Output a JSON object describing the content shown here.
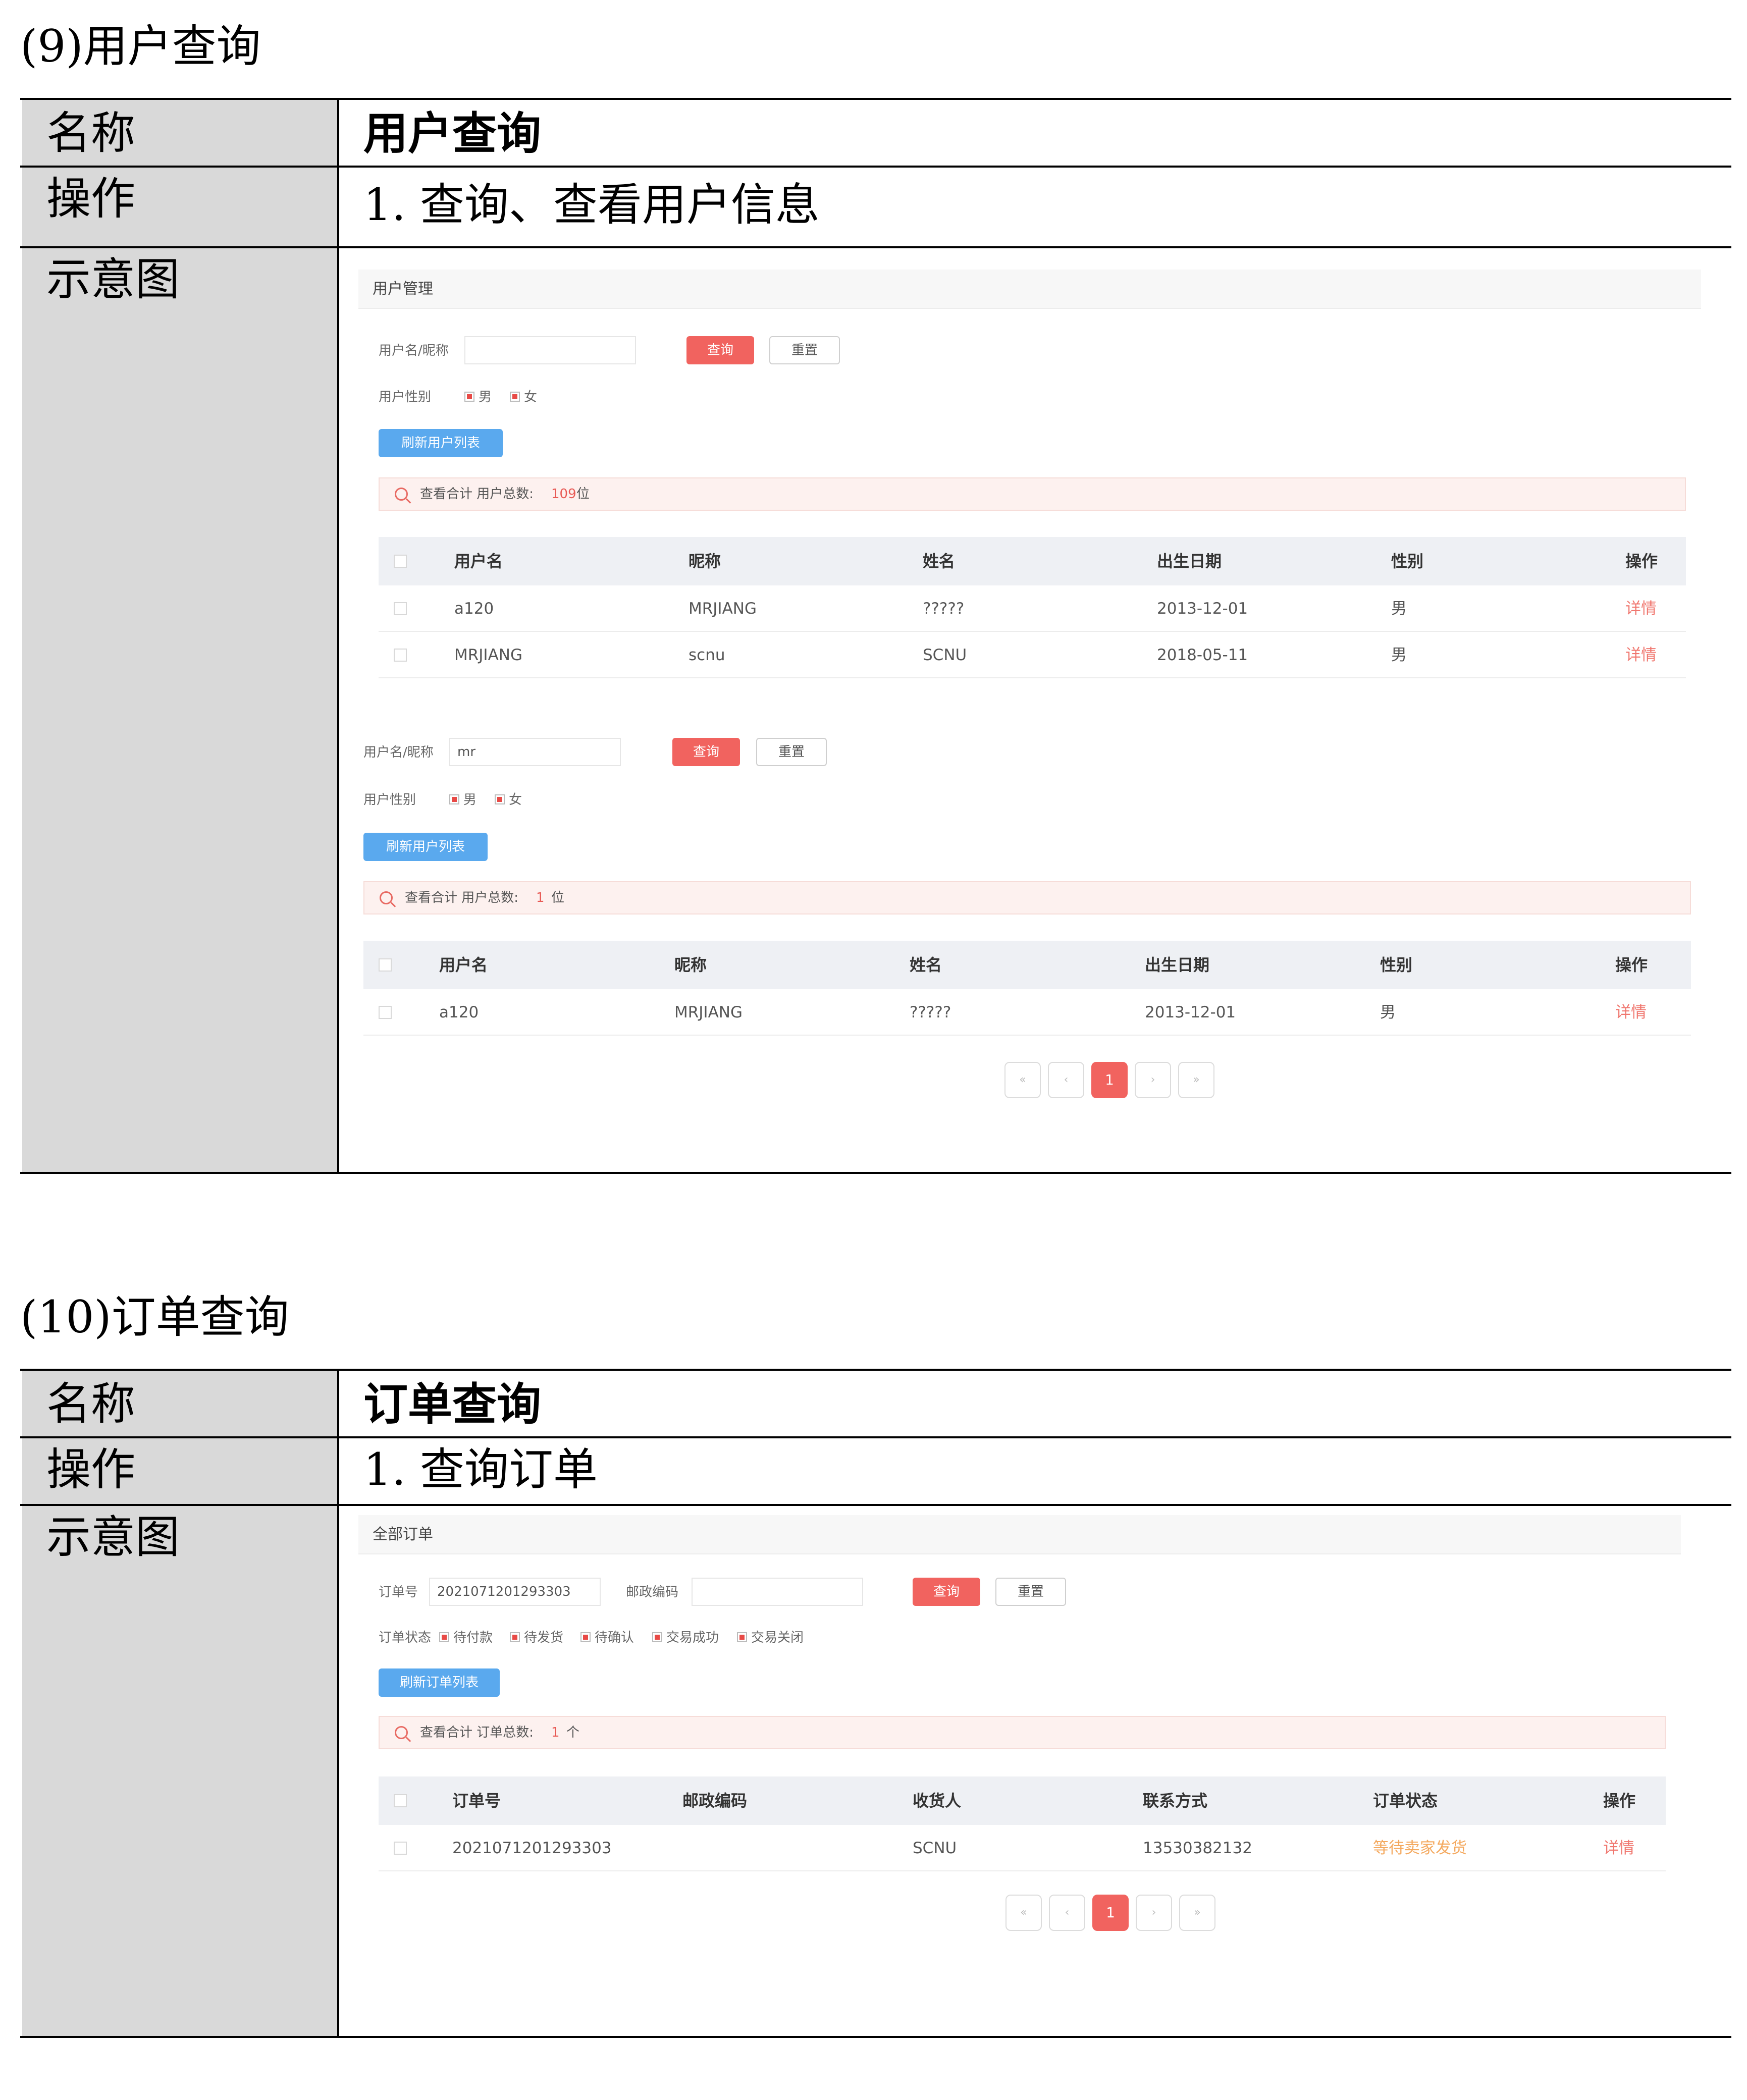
{
  "section1": {
    "heading": "(9)用户查询",
    "name_label": "名称",
    "name_value": "用户查询",
    "op_label": "操作",
    "op_value": "1.  查询、查看用户信息",
    "diagram_label": "示意图",
    "shot": {
      "title": "用户管理",
      "panel1": {
        "field_label": "用户名/昵称",
        "field_value": "",
        "query_button": "查询",
        "reset_button": "重置",
        "gender_label": "用户性别",
        "gender_male": "男",
        "gender_female": "女",
        "refresh_button": "刷新用户列表",
        "summary_prefix": "查看合计   用户总数:",
        "summary_count": "109",
        "summary_unit": "位",
        "columns": [
          "用户名",
          "昵称",
          "姓名",
          "出生日期",
          "性别",
          "操作"
        ],
        "rows": [
          [
            "a120",
            "MRJIANG",
            "?????",
            "2013-12-01",
            "男",
            "详情"
          ],
          [
            "MRJIANG",
            "scnu",
            "SCNU",
            "2018-05-11",
            "男",
            "详情"
          ]
        ]
      },
      "panel2": {
        "field_label": "用户名/昵称",
        "field_value": "mr",
        "query_button": "查询",
        "reset_button": "重置",
        "gender_label": "用户性别",
        "gender_male": "男",
        "gender_female": "女",
        "refresh_button": "刷新用户列表",
        "summary_prefix": "查看合计   用户总数:",
        "summary_count": "1",
        "summary_unit": "位",
        "columns": [
          "用户名",
          "昵称",
          "姓名",
          "出生日期",
          "性别",
          "操作"
        ],
        "rows": [
          [
            "a120",
            "MRJIANG",
            "?????",
            "2013-12-01",
            "男",
            "详情"
          ]
        ],
        "pagination": {
          "first": "«",
          "prev": "‹",
          "current": "1",
          "next": "›",
          "last": "»"
        }
      }
    }
  },
  "section2": {
    "heading": "(10)订单查询",
    "name_label": "名称",
    "name_value": "订单查询",
    "op_label": "操作",
    "op_value": "1.  查询订单",
    "diagram_label": "示意图",
    "shot": {
      "title": "全部订单",
      "order_label": "订单号",
      "order_value": "2021071201293303",
      "postcode_label": "邮政编码",
      "postcode_value": "",
      "query_button": "查询",
      "reset_button": "重置",
      "status_label": "订单状态",
      "status_options": [
        "待付款",
        "待发货",
        "待确认",
        "交易成功",
        "交易关闭"
      ],
      "refresh_button": "刷新订单列表",
      "summary_prefix": "查看合计   订单总数:",
      "summary_count": "1",
      "summary_unit": "个",
      "columns": [
        "订单号",
        "邮政编码",
        "收货人",
        "联系方式",
        "订单状态",
        "操作"
      ],
      "rows": [
        [
          "2021071201293303",
          "",
          "SCNU",
          "13530382132",
          "等待卖家发货",
          "详情"
        ]
      ],
      "pagination": {
        "first": "«",
        "prev": "‹",
        "current": "1",
        "next": "›",
        "last": "»"
      }
    }
  }
}
